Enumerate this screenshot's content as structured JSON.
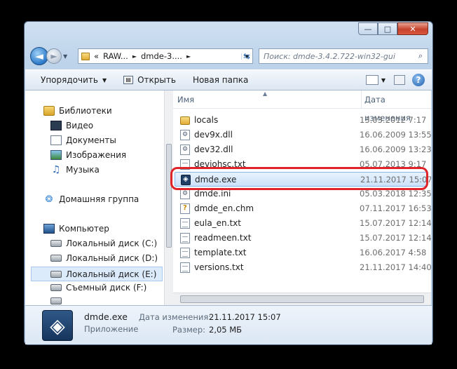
{
  "window": {
    "minimize_glyph": "—",
    "maximize_glyph": "□",
    "close_glyph": "✕"
  },
  "address": {
    "prefix": "«",
    "crumbs": [
      "RAW...",
      "dmde-3...."
    ],
    "separator": "►",
    "dropdown_glyph": "▼"
  },
  "search": {
    "placeholder": "Поиск: dmde-3.4.2.722-win32-gui",
    "icon": "search-icon"
  },
  "toolbar": {
    "organize_label": "Упорядочить",
    "open_label": "Открыть",
    "new_folder_label": "Новая папка"
  },
  "sidebar": {
    "libraries": "Библиотеки",
    "items": [
      "Видео",
      "Документы",
      "Изображения",
      "Музыка"
    ],
    "homegroup": "Домашняя группа",
    "computer": "Компьютер",
    "drives": [
      "Локальный диск (C:)",
      "Локальный диск (D:)",
      "Локальный диск (E:)",
      "Съемный диск (F:)"
    ],
    "selected_drive": "Локальный диск (E:)"
  },
  "columns": {
    "name": "Имя",
    "date": "Дата изменения"
  },
  "files": [
    {
      "name": "locals",
      "date": "13.03.2012 7:17",
      "type": "folder"
    },
    {
      "name": "dev9x.dll",
      "date": "16.06.2009 13:55",
      "type": "dll"
    },
    {
      "name": "dev32.dll",
      "date": "16.06.2009 13:23",
      "type": "dll"
    },
    {
      "name": "deviohsc.txt",
      "date": "05.07.2013 9:17",
      "type": "txt"
    },
    {
      "name": "dmde.exe",
      "date": "21.11.2017 15:07",
      "type": "exe"
    },
    {
      "name": "dmde.ini",
      "date": "05.03.2018 12:35",
      "type": "ini"
    },
    {
      "name": "dmde_en.chm",
      "date": "07.11.2017 16:53",
      "type": "chm"
    },
    {
      "name": "eula_en.txt",
      "date": "15.07.2017 12:14",
      "type": "txt"
    },
    {
      "name": "readmeen.txt",
      "date": "15.07.2017 12:14",
      "type": "txt"
    },
    {
      "name": "template.txt",
      "date": "16.06.2017 4:58",
      "type": "txt"
    },
    {
      "name": "versions.txt",
      "date": "21.11.2017 14:40",
      "type": "txt"
    }
  ],
  "selected_file": "dmde.exe",
  "details": {
    "name": "dmde.exe",
    "type": "Приложение",
    "modified_label": "Дата изменения:",
    "modified_value": "21.11.2017 15:07",
    "size_label": "Размер:",
    "size_value": "2,05 МБ"
  },
  "colors": {
    "highlight_ring": "#e0252a",
    "selection": "#cce2fa"
  }
}
